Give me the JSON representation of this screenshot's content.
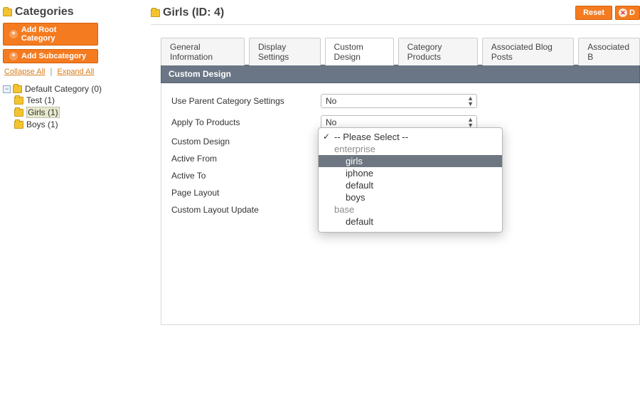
{
  "sidebar": {
    "title": "Categories",
    "addRoot": "Add Root Category",
    "addSub": "Add Subcategory",
    "collapse": "Collapse All",
    "expand": "Expand All",
    "root": {
      "label": "Default Category (0)"
    },
    "children": [
      {
        "label": "Test (1)"
      },
      {
        "label": "Girls (1)",
        "selected": true
      },
      {
        "label": "Boys (1)"
      }
    ]
  },
  "page": {
    "title": "Girls (ID: 4)",
    "reset": "Reset",
    "delete": "D"
  },
  "tabs": [
    "General Information",
    "Display Settings",
    "Custom Design",
    "Category Products",
    "Associated Blog Posts",
    "Associated B"
  ],
  "activeTab": 2,
  "section": {
    "title": "Custom Design"
  },
  "form": {
    "useParent": {
      "label": "Use Parent Category Settings",
      "value": "No"
    },
    "applyTo": {
      "label": "Apply To Products",
      "value": "No"
    },
    "customDesign": {
      "label": "Custom Design"
    },
    "activeFrom": {
      "label": "Active From"
    },
    "activeTo": {
      "label": "Active To"
    },
    "pageLayout": {
      "label": "Page Layout"
    },
    "layoutUpdate": {
      "label": "Custom Layout Update"
    }
  },
  "dropdown": {
    "placeholder": "-- Please Select --",
    "groups": [
      {
        "name": "enterprise",
        "options": [
          "girls",
          "iphone",
          "default",
          "boys"
        ]
      },
      {
        "name": "base",
        "options": [
          "default"
        ]
      }
    ],
    "highlighted": "girls"
  }
}
